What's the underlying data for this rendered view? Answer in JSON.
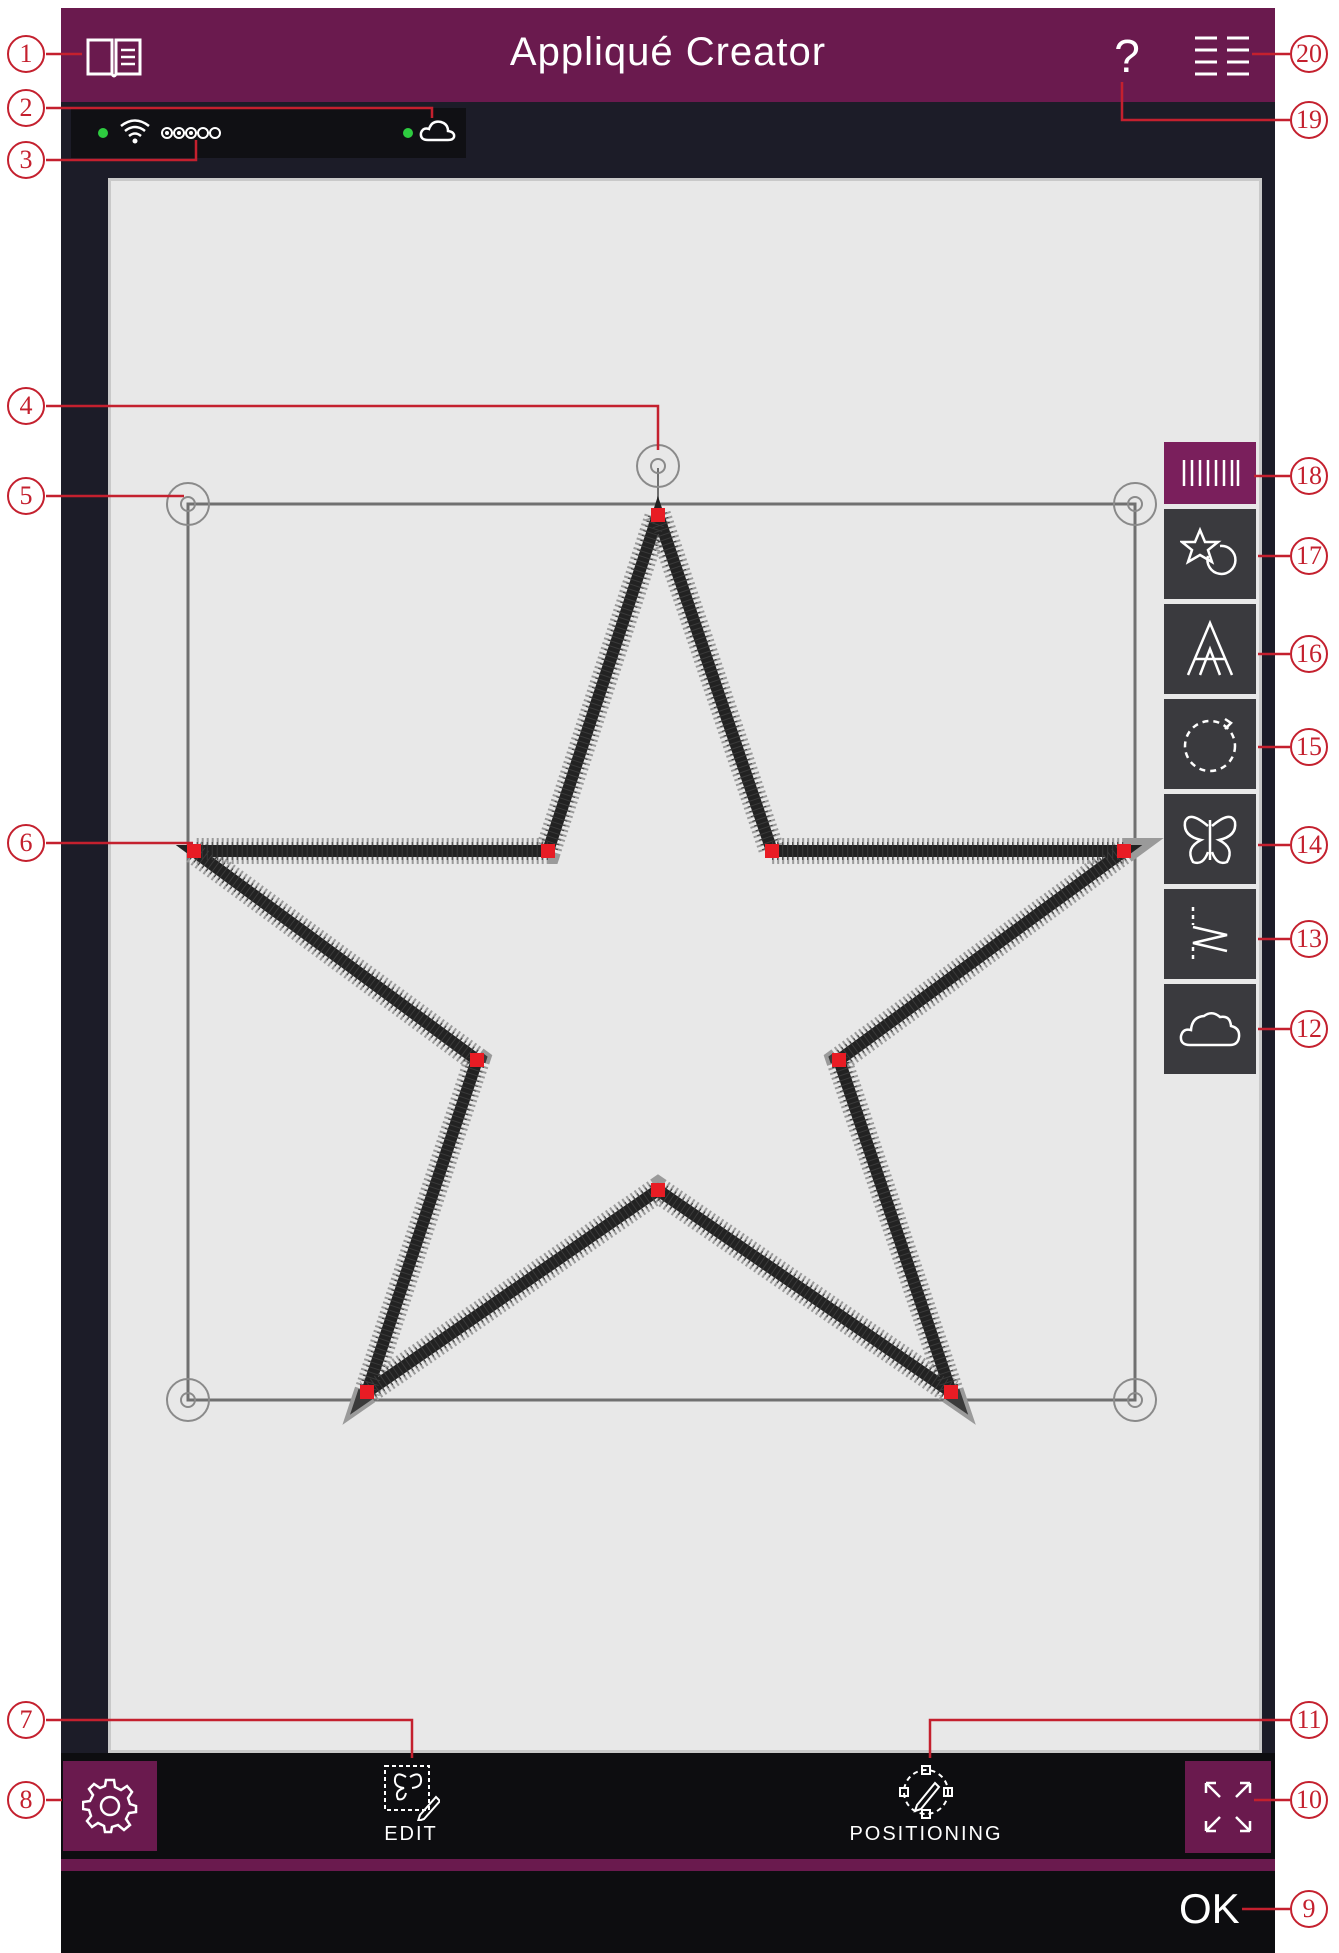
{
  "app": {
    "title": "Appliqué Creator",
    "accent_color": "#6a1a4e"
  },
  "header": {
    "left_icon": "book-icon",
    "help_label": "?",
    "menu_icon": "list-menu-icon"
  },
  "status": {
    "wifi_icon": "wifi-icon",
    "signal_icon": "signal-dots-icon",
    "cloud_icon": "cloud-icon",
    "dot_color": "#2ecc40"
  },
  "toolbar": {
    "items": [
      {
        "icon": "stitch-ruler-icon",
        "active": true
      },
      {
        "icon": "star-rotate-icon"
      },
      {
        "icon": "letter-a-icon"
      },
      {
        "icon": "dashed-circle-rotate-icon"
      },
      {
        "icon": "butterfly-icon"
      },
      {
        "icon": "zigzag-stitch-icon"
      },
      {
        "icon": "cloud-shape-icon"
      }
    ]
  },
  "bottom": {
    "settings_icon": "gear-icon",
    "edit_label": "EDIT",
    "positioning_label": "POSITIONING",
    "fit_icon": "expand-arrows-icon"
  },
  "ok_label": "OK",
  "callouts": [
    "1",
    "2",
    "3",
    "4",
    "5",
    "6",
    "7",
    "8",
    "9",
    "10",
    "11",
    "12",
    "13",
    "14",
    "15",
    "16",
    "17",
    "18",
    "19",
    "20"
  ],
  "callout_color": "#c4202e"
}
